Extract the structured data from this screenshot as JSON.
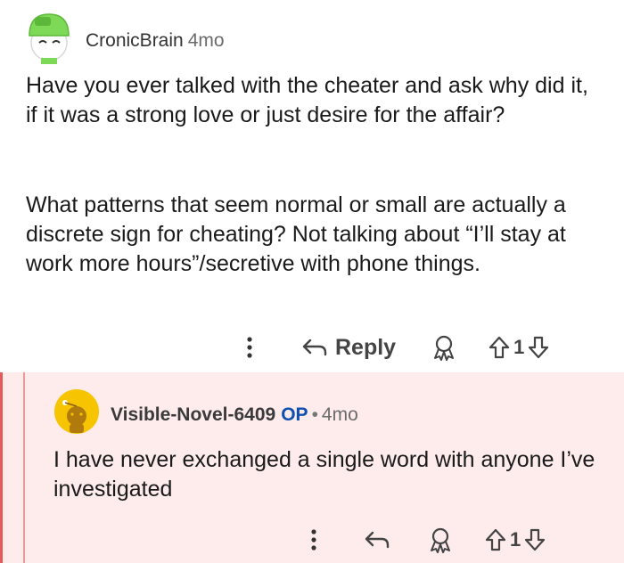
{
  "comment": {
    "username": "CronicBrain",
    "time": "4mo",
    "paragraph1": "Have you ever talked with the cheater and ask why did it, if it was a strong love or just desire for the affair?",
    "paragraph2": "What patterns that seem normal or small are actually a discrete sign for cheating? Not talking about “I’ll stay at work more hours”/secretive with phone things.",
    "reply_label": "Reply",
    "score": "1",
    "icons": [
      "more-options-icon",
      "reply-arrow-icon",
      "award-icon",
      "upvote-icon",
      "downvote-icon"
    ]
  },
  "reply": {
    "username": "Visible-Novel-6409",
    "op_badge": "OP",
    "separator": "•",
    "time": "4mo",
    "text": "I have never exchanged a single word with anyone I’ve investigated",
    "score": "1"
  },
  "colors": {
    "reply_background": "#fdeceb",
    "reply_accent": "#e35b56",
    "op_badge": "#0f4fb0",
    "avatar1_accent": "#7ed957",
    "avatar2_accent": "#f6c400"
  }
}
